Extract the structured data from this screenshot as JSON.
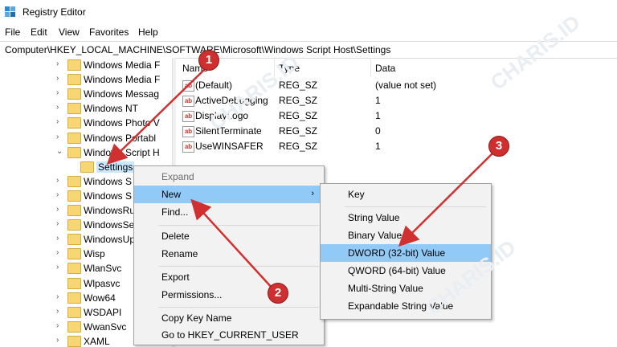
{
  "window": {
    "title": "Registry Editor"
  },
  "menu": [
    "File",
    "Edit",
    "View",
    "Favorites",
    "Help"
  ],
  "address": "Computer\\HKEY_LOCAL_MACHINE\\SOFTWARE\\Microsoft\\Windows Script Host\\Settings",
  "tree": {
    "items": [
      {
        "label": "Windows Media F",
        "arrow": "›"
      },
      {
        "label": "Windows Media F",
        "arrow": "›"
      },
      {
        "label": "Windows Messag",
        "arrow": "›"
      },
      {
        "label": "Windows NT",
        "arrow": "›"
      },
      {
        "label": "Windows Photo V",
        "arrow": "›"
      },
      {
        "label": "Windows Portabl",
        "arrow": "›"
      },
      {
        "label": "Windows Script H",
        "arrow": "⌄"
      },
      {
        "label": "Settings",
        "arrow": ""
      },
      {
        "label": "Windows S",
        "arrow": "›"
      },
      {
        "label": "Windows S",
        "arrow": "›"
      },
      {
        "label": "WindowsRu",
        "arrow": "›"
      },
      {
        "label": "WindowsSe",
        "arrow": "›"
      },
      {
        "label": "WindowsUp",
        "arrow": "›"
      },
      {
        "label": "Wisp",
        "arrow": "›"
      },
      {
        "label": "WlanSvc",
        "arrow": "›"
      },
      {
        "label": "Wlpasvc",
        "arrow": ""
      },
      {
        "label": "Wow64",
        "arrow": "›"
      },
      {
        "label": "WSDAPI",
        "arrow": "›"
      },
      {
        "label": "WwanSvc",
        "arrow": "›"
      },
      {
        "label": "XAML",
        "arrow": "›"
      }
    ]
  },
  "list": {
    "columns": [
      "Name",
      "Type",
      "Data"
    ],
    "rows": [
      {
        "name": "(Default)",
        "type": "REG_SZ",
        "data": "(value not set)"
      },
      {
        "name": "ActiveDebugging",
        "type": "REG_SZ",
        "data": "1"
      },
      {
        "name": "DisplayLogo",
        "type": "REG_SZ",
        "data": "1"
      },
      {
        "name": "SilentTerminate",
        "type": "REG_SZ",
        "data": "0"
      },
      {
        "name": "UseWINSAFER",
        "type": "REG_SZ",
        "data": "1"
      }
    ],
    "icon_text": "ab"
  },
  "context_menu": {
    "expand": "Expand",
    "new": "New",
    "find": "Find...",
    "delete": "Delete",
    "rename": "Rename",
    "export": "Export",
    "permissions": "Permissions...",
    "copy_key_name": "Copy Key Name",
    "goto": "Go to HKEY_CURRENT_USER",
    "submenu_arrow": "›"
  },
  "submenu": {
    "key": "Key",
    "string": "String Value",
    "binary": "Binary Value",
    "dword": "DWORD (32-bit) Value",
    "qword": "QWORD (64-bit) Value",
    "multi": "Multi-String Value",
    "expandable": "Expandable String Value"
  },
  "badges": [
    "1",
    "2",
    "3"
  ],
  "watermark": "CHARIS.ID",
  "colors": {
    "highlight": "#91c9f7",
    "badge": "#cf2f2f",
    "arrow": "#d03030"
  }
}
